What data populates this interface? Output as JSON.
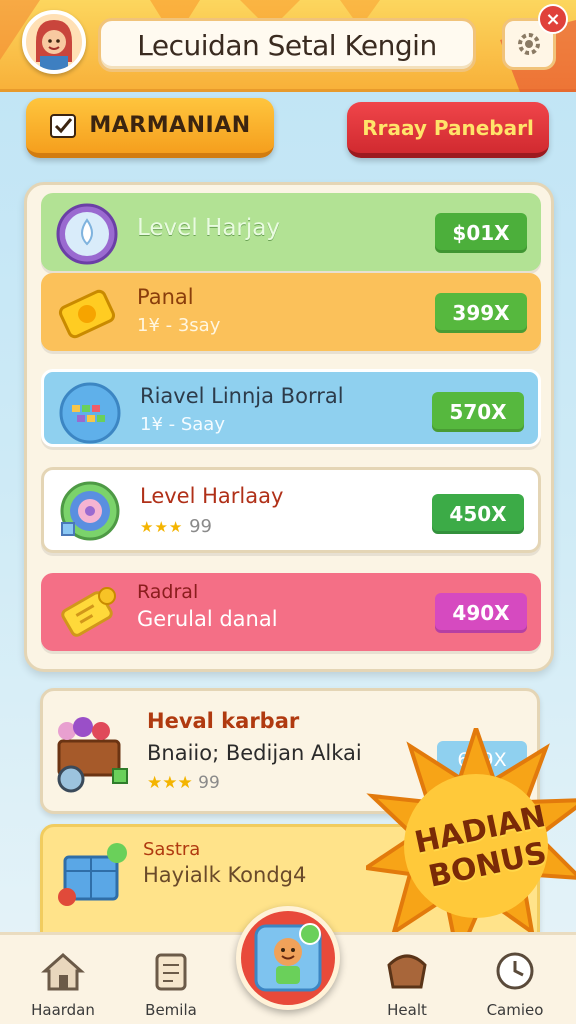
{
  "header": {
    "title": "Leсuidan Setal Kengin",
    "close_label": "×"
  },
  "actions": {
    "primary_label": "MARMANIAN",
    "secondary_label": "Rraay Panebarl"
  },
  "list": [
    {
      "title": "Level Harjay",
      "subtitle": "",
      "value": "$01X",
      "badge_color": "#4caf3b",
      "bg": "#a9df8a"
    },
    {
      "title": "Panal",
      "subtitle": "1¥ - 3say",
      "value": "399X",
      "badge_color": "#56b83e",
      "bg": "#fbc15a"
    },
    {
      "title": "Riavel Linnja Borral",
      "subtitle": "1¥ - Saay",
      "value": "570X",
      "badge_color": "#56b83e",
      "bg": "#8fd0ef"
    },
    {
      "title": "Level Harlaay",
      "subtitle": "99",
      "value": "450X",
      "badge_color": "#3cab47",
      "bg": "#ffffff",
      "stars": "★★★"
    },
    {
      "title": "Radral",
      "subtitle": "Gerulal danal",
      "value": "490X",
      "badge_color": "#d64ac0",
      "bg": "#f46f86"
    }
  ],
  "cards": [
    {
      "title": "Heval karbar",
      "subtitle": "Bnaiio; Bedijan Alkai",
      "stars": "★★★",
      "count": "99",
      "value": "699X"
    },
    {
      "title": "Sastra",
      "subtitle": "Hayialk Kondg4"
    }
  ],
  "bonus": {
    "line1": "HADIAN",
    "line2": "BONUS"
  },
  "nav": [
    {
      "label": "Haardan",
      "icon": "house-icon"
    },
    {
      "label": "Bemila",
      "icon": "scroll-icon"
    },
    {
      "label": "Healt",
      "icon": "basket-icon"
    },
    {
      "label": "Camieo",
      "icon": "clock-icon"
    }
  ]
}
